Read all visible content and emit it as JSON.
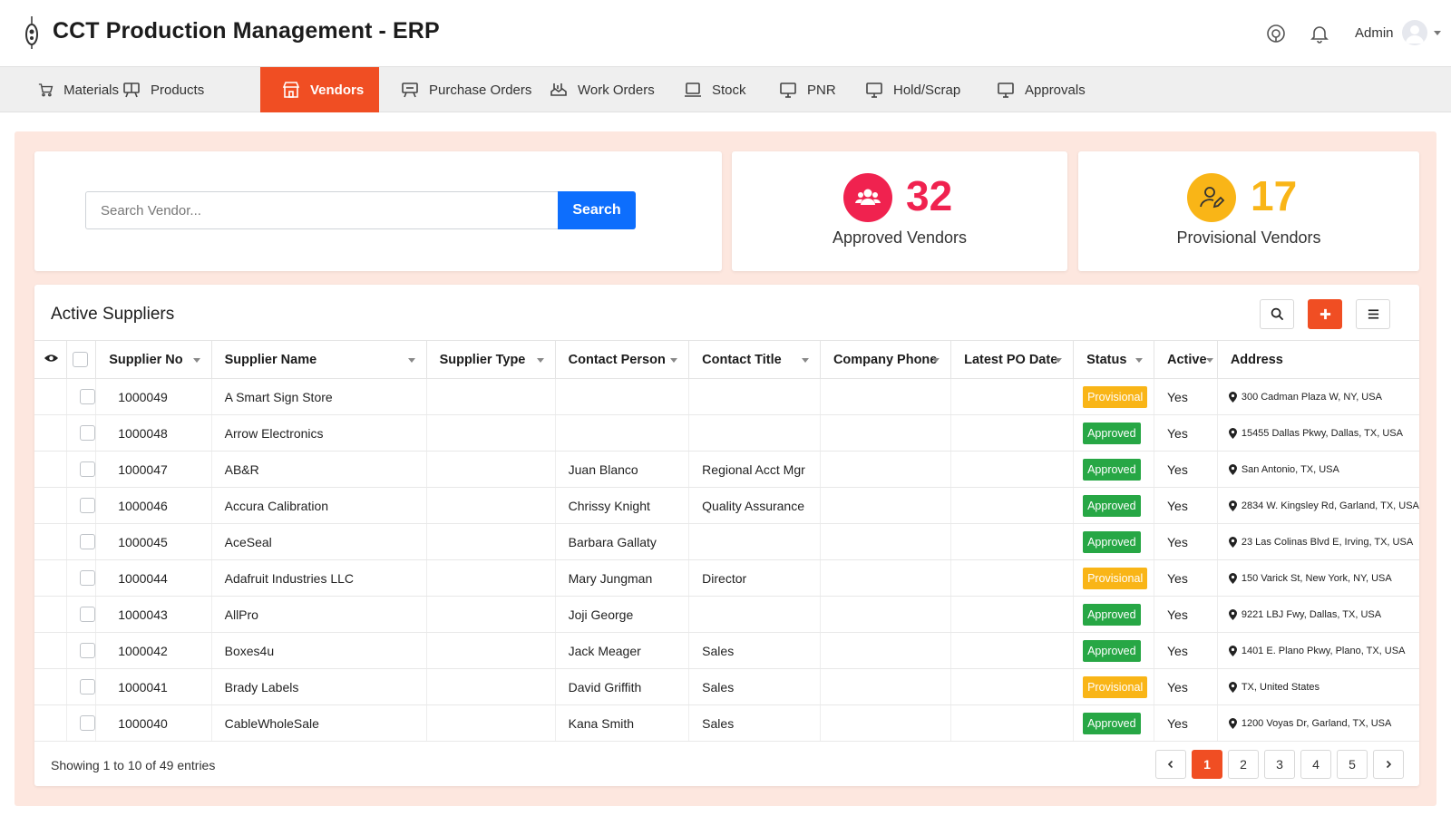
{
  "header": {
    "title": "CCT Production Management - ERP",
    "user": "Admin"
  },
  "nav": [
    {
      "label": "Materials",
      "icon": "cart-icon",
      "active": false
    },
    {
      "label": "Products",
      "icon": "products-icon",
      "active": false
    },
    {
      "label": "Vendors",
      "icon": "store-icon",
      "active": true
    },
    {
      "label": "Purchase Orders",
      "icon": "purchase-orders-icon",
      "active": false
    },
    {
      "label": "Work Orders",
      "icon": "work-orders-icon",
      "active": false
    },
    {
      "label": "Stock",
      "icon": "stock-icon",
      "active": false
    },
    {
      "label": "PNR",
      "icon": "monitor-icon",
      "active": false
    },
    {
      "label": "Hold/Scrap",
      "icon": "monitor-icon",
      "active": false
    },
    {
      "label": "Approvals",
      "icon": "monitor-icon",
      "active": false
    }
  ],
  "search": {
    "placeholder": "Search Vendor...",
    "button": "Search"
  },
  "stats": {
    "approved": {
      "count": "32",
      "label": "Approved Vendors",
      "color": "#f0224f"
    },
    "provisional": {
      "count": "17",
      "label": "Provisional Vendors",
      "color": "#f9b517"
    }
  },
  "table": {
    "title": "Active Suppliers",
    "columns": [
      "Supplier No",
      "Supplier Name",
      "Supplier Type",
      "Contact Person",
      "Contact Title",
      "Company Phone",
      "Latest PO Date",
      "Status",
      "Active",
      "Address"
    ],
    "rows": [
      {
        "no": "1000049",
        "name": "A Smart Sign Store",
        "type": "",
        "contact": "",
        "title": "",
        "phone": "",
        "po": "",
        "status": "Provisional",
        "active": "Yes",
        "address": "300 Cadman Plaza W, NY, USA"
      },
      {
        "no": "1000048",
        "name": "Arrow Electronics",
        "type": "",
        "contact": "",
        "title": "",
        "phone": "",
        "po": "",
        "status": "Approved",
        "active": "Yes",
        "address": "15455 Dallas Pkwy, Dallas, TX, USA"
      },
      {
        "no": "1000047",
        "name": "AB&R",
        "type": "",
        "contact": "Juan Blanco",
        "title": "Regional Acct Mgr",
        "phone": "",
        "po": "",
        "status": "Approved",
        "active": "Yes",
        "address": "San Antonio, TX, USA"
      },
      {
        "no": "1000046",
        "name": "Accura Calibration",
        "type": "",
        "contact": "Chrissy Knight",
        "title": "Quality Assurance",
        "phone": "",
        "po": "",
        "status": "Approved",
        "active": "Yes",
        "address": "2834 W. Kingsley Rd, Garland, TX, USA"
      },
      {
        "no": "1000045",
        "name": "AceSeal",
        "type": "",
        "contact": "Barbara Gallaty",
        "title": "",
        "phone": "",
        "po": "",
        "status": "Approved",
        "active": "Yes",
        "address": "23 Las Colinas Blvd E, Irving, TX, USA"
      },
      {
        "no": "1000044",
        "name": "Adafruit Industries LLC",
        "type": "",
        "contact": "Mary Jungman",
        "title": "Director",
        "phone": "",
        "po": "",
        "status": "Provisional",
        "active": "Yes",
        "address": "150 Varick St, New York, NY, USA"
      },
      {
        "no": "1000043",
        "name": "AllPro",
        "type": "",
        "contact": "Joji George",
        "title": "",
        "phone": "",
        "po": "",
        "status": "Approved",
        "active": "Yes",
        "address": "9221 LBJ Fwy, Dallas, TX, USA"
      },
      {
        "no": "1000042",
        "name": "Boxes4u",
        "type": "",
        "contact": "Jack Meager",
        "title": "Sales",
        "phone": "",
        "po": "",
        "status": "Approved",
        "active": "Yes",
        "address": "1401 E. Plano Pkwy, Plano, TX, USA"
      },
      {
        "no": "1000041",
        "name": "Brady Labels",
        "type": "",
        "contact": "David Griffith",
        "title": "Sales",
        "phone": "",
        "po": "",
        "status": "Provisional",
        "active": "Yes",
        "address": "TX, United States"
      },
      {
        "no": "1000040",
        "name": "CableWholeSale",
        "type": "",
        "contact": "Kana Smith",
        "title": "Sales",
        "phone": "",
        "po": "",
        "status": "Approved",
        "active": "Yes",
        "address": "1200 Voyas Dr, Garland, TX, USA"
      }
    ],
    "footer": "Showing 1 to 10 of 49 entries",
    "pages": [
      "1",
      "2",
      "3",
      "4",
      "5"
    ],
    "current_page": "1"
  },
  "colors": {
    "accent": "#f04e23",
    "primary": "#0d6efd",
    "approved": "#27a745",
    "provisional": "#f9b517",
    "background": "#fde7df"
  }
}
